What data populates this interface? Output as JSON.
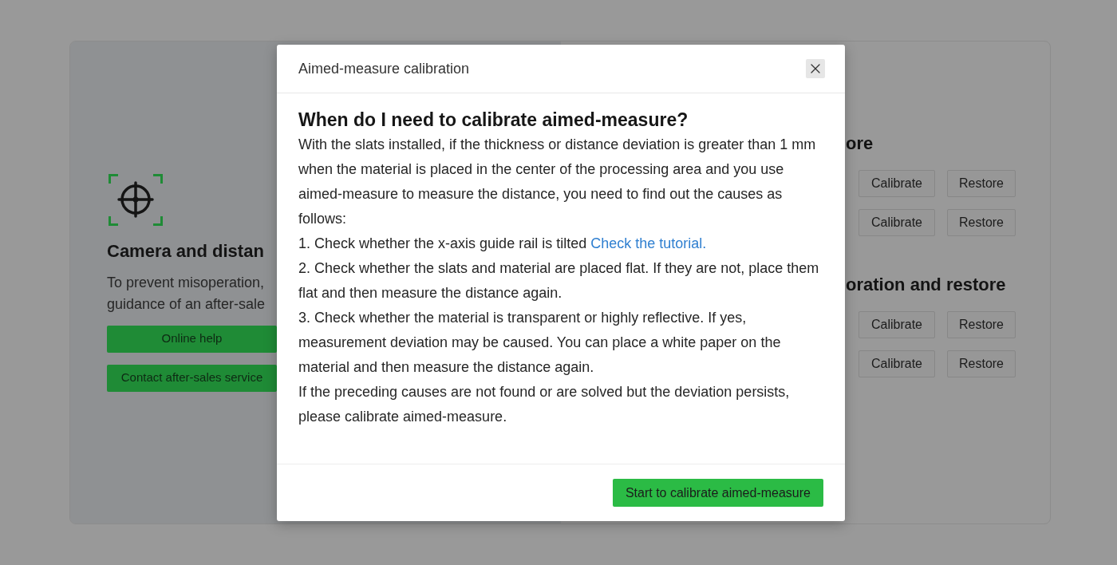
{
  "background": {
    "left_panel": {
      "title": "Camera and distan",
      "description_lines": [
        "To prevent misoperation,",
        "guidance of an after-sale"
      ],
      "buttons": [
        "Online help",
        "Contact after-sales service"
      ]
    },
    "right_panel": {
      "sections": [
        {
          "title": "ore",
          "rows": [
            {
              "buttons": [
                "Calibrate",
                "Restore"
              ]
            },
            {
              "buttons": [
                "Calibrate",
                "Restore"
              ]
            }
          ]
        },
        {
          "title": "oration and restore",
          "rows": [
            {
              "buttons": [
                "Calibrate",
                "Restore"
              ]
            },
            {
              "buttons": [
                "Calibrate",
                "Restore"
              ]
            }
          ]
        }
      ]
    }
  },
  "dialog": {
    "title": "Aimed-measure calibration",
    "heading": "When do I need to calibrate aimed-measure?",
    "paragraphs": [
      {
        "text": "With the slats installed, if the thickness or distance deviation is greater than 1 mm when the material is placed in the center of the processing area and you use aimed-measure to measure the distance, you need to find out the causes as follows:"
      },
      {
        "text": "1. Check whether the x-axis guide rail is tilted",
        "link": "Check the tutorial."
      },
      {
        "text": "2. Check whether the slats and material are placed flat. If they are not, place them flat and then measure the distance again."
      },
      {
        "text": "3. Check whether the material is transparent or highly reflective. If yes, measurement deviation may be caused. You can place a white paper on the material and then measure the distance again."
      },
      {
        "text": "If the preceding causes are not found or are solved but the deviation persists, please calibrate aimed-measure."
      }
    ],
    "primary_button": "Start to calibrate aimed-measure"
  }
}
